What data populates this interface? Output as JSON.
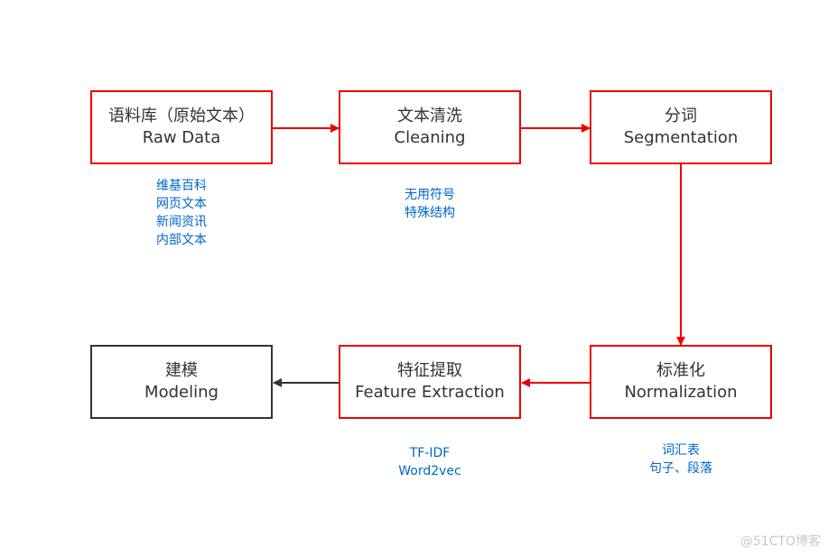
{
  "nodes": {
    "raw_data": {
      "zh": "语料库（原始文本）",
      "en": "Raw Data"
    },
    "cleaning": {
      "zh": "文本清洗",
      "en": "Cleaning"
    },
    "segmentation": {
      "zh": "分词",
      "en": "Segmentation"
    },
    "normalization": {
      "zh": "标准化",
      "en": "Normalization"
    },
    "feature_extraction": {
      "zh": "特征提取",
      "en": "Feature Extraction"
    },
    "modeling": {
      "zh": "建模",
      "en": "Modeling"
    }
  },
  "notes": {
    "raw_data": [
      "维基百科",
      "网页文本",
      "新闻资讯",
      "内部文本"
    ],
    "cleaning": [
      "无用符号",
      "特殊结构"
    ],
    "normalization": [
      "词汇表",
      "句子、段落"
    ],
    "feature_extraction": [
      "TF-IDF",
      "Word2vec"
    ]
  },
  "edges": [
    {
      "from": "raw_data",
      "to": "cleaning",
      "color": "#ee0000"
    },
    {
      "from": "cleaning",
      "to": "segmentation",
      "color": "#ee0000"
    },
    {
      "from": "segmentation",
      "to": "normalization",
      "color": "#ee0000"
    },
    {
      "from": "normalization",
      "to": "feature_extraction",
      "color": "#ee0000"
    },
    {
      "from": "feature_extraction",
      "to": "modeling",
      "color": "#333333"
    }
  ],
  "watermark": "@51CTO博客"
}
